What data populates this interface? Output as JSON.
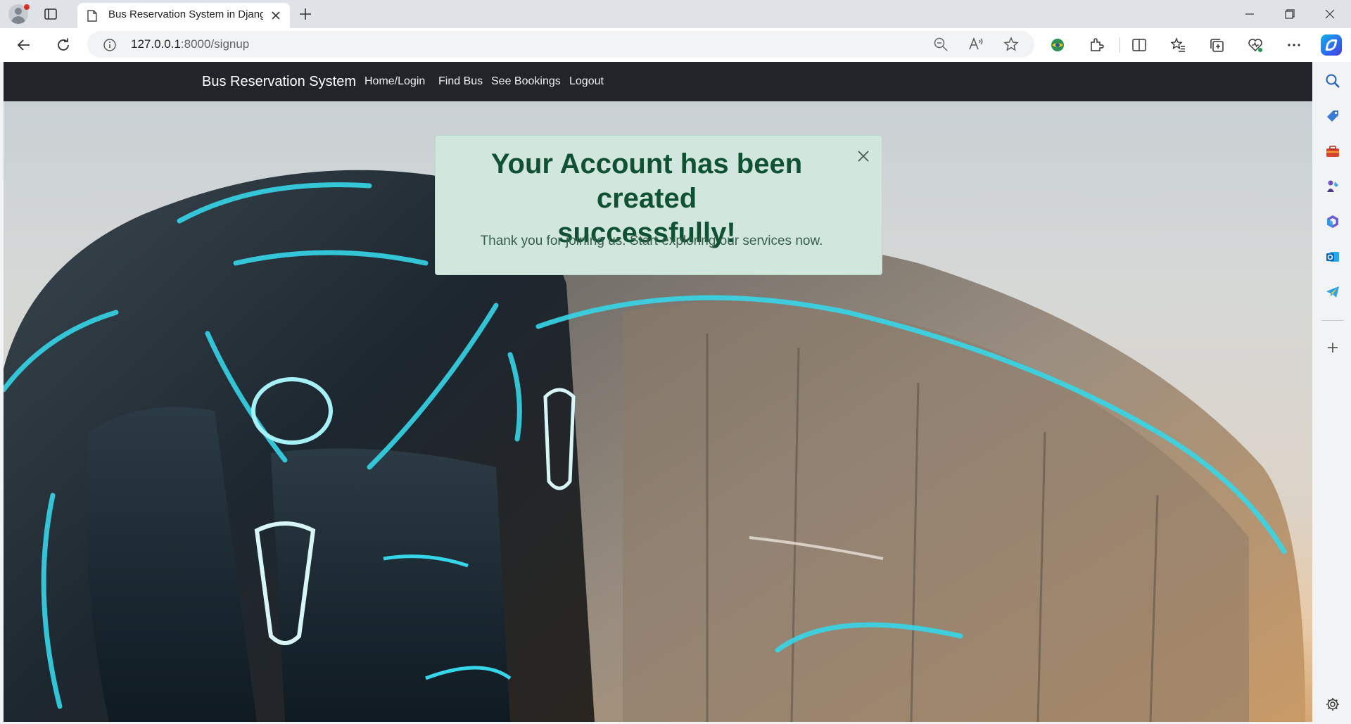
{
  "browser": {
    "tab_title": "Bus Reservation System in Djang",
    "url_host": "127.0.0.1",
    "url_rest": ":8000/signup"
  },
  "navbar": {
    "brand": "Bus Reservation System",
    "links": [
      {
        "label": "Home/Login"
      },
      {
        "label": "Find Bus"
      },
      {
        "label": "See Bookings"
      },
      {
        "label": "Logout"
      }
    ]
  },
  "alert": {
    "heading_line1": "Your Account has been created",
    "heading_line2": "successfully!",
    "message": "Thank you for joining us. Start exploring our services now."
  },
  "colors": {
    "navbar_bg": "#212529",
    "alert_bg": "#d1e7dd",
    "alert_text": "#0f5132",
    "hero_glow": "#35d6e8"
  },
  "icons": {
    "toolbar": [
      "back-icon",
      "refresh-icon",
      "site-info-icon",
      "zoom-out-icon",
      "read-aloud-icon",
      "favorite-star-icon",
      "extension-globe-icon",
      "extensions-icon",
      "split-screen-icon",
      "favorites-icon",
      "collections-icon",
      "browser-essentials-icon",
      "more-icon",
      "copilot-icon"
    ],
    "sidebar": [
      "search-icon",
      "shopping-tag-icon",
      "tools-icon",
      "games-icon",
      "microsoft365-icon",
      "outlook-icon",
      "telegram-icon",
      "add-icon",
      "settings-icon"
    ]
  }
}
